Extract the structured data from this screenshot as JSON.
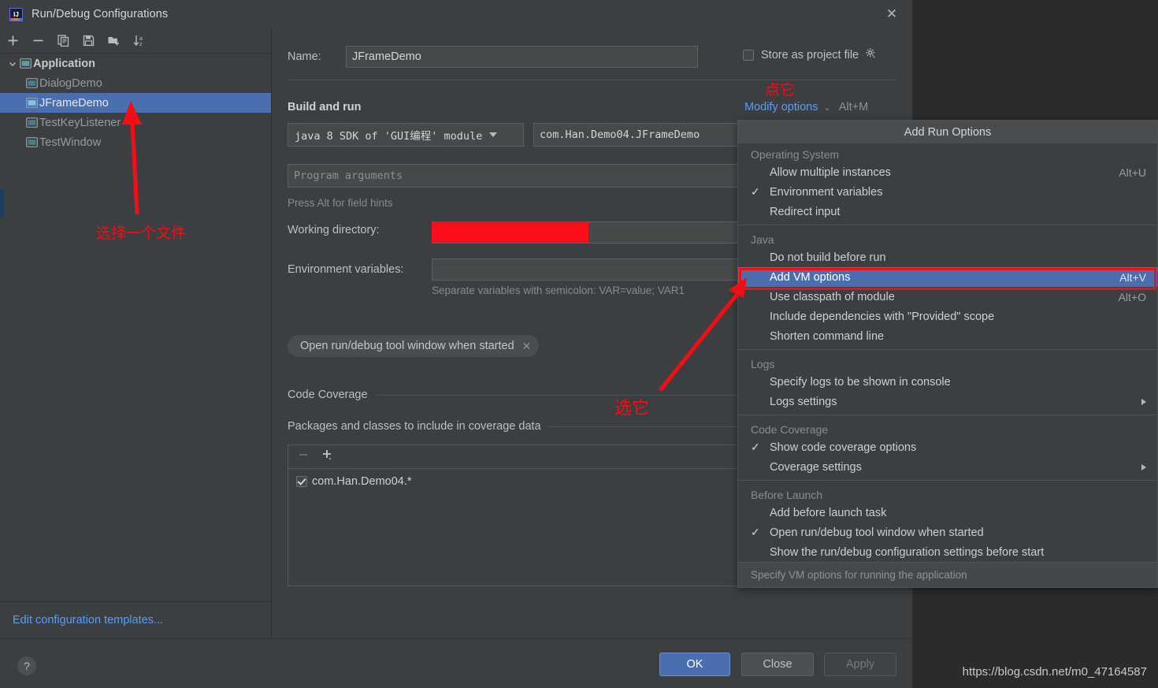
{
  "window": {
    "title": "Run/Debug Configurations",
    "app_icon": "intellij-idea-icon",
    "close_icon": "close-icon"
  },
  "sidebar": {
    "toolbar": [
      {
        "name": "add-configuration-button",
        "icon": "plus-icon"
      },
      {
        "name": "remove-configuration-button",
        "icon": "minus-icon"
      },
      {
        "name": "copy-configuration-button",
        "icon": "copy-icon"
      },
      {
        "name": "save-configuration-button",
        "icon": "save-icon"
      },
      {
        "name": "move-to-folder-button",
        "icon": "folder-add-icon"
      },
      {
        "name": "sort-configurations-button",
        "icon": "sort-az-icon"
      }
    ],
    "tree": [
      {
        "label": "Application",
        "level": 0,
        "expanded": true,
        "selected": false
      },
      {
        "label": "DialogDemo",
        "level": 1,
        "expanded": false,
        "selected": false
      },
      {
        "label": "JFrameDemo",
        "level": 1,
        "expanded": false,
        "selected": true
      },
      {
        "label": "TestKeyListener",
        "level": 1,
        "expanded": false,
        "selected": false
      },
      {
        "label": "TestWindow",
        "level": 1,
        "expanded": false,
        "selected": false
      }
    ],
    "footer_link": "Edit configuration templates..."
  },
  "form": {
    "name_label": "Name:",
    "name_value": "JFrameDemo",
    "store_as_project_file_label": "Store as project file",
    "store_as_project_file_checked": false,
    "store_gear_icon": "gear-dropdown-icon",
    "build_and_run_title": "Build and run",
    "modify_options_label": "Modify options",
    "modify_options_accel": "Alt+M",
    "sdk_value": "java 8 SDK of 'GUI编程' module",
    "main_class_value": "com.Han.Demo04.JFrameDemo",
    "program_arguments_placeholder": "Program arguments",
    "field_hint": "Press Alt for field hints",
    "working_directory_label": "Working directory:",
    "working_directory_value": "",
    "environment_variables_label": "Environment variables:",
    "environment_variables_value": "",
    "env_hint": "Separate variables with semicolon: VAR=value; VAR1",
    "tag_chip_label": "Open run/debug tool window when started",
    "tag_chip_close_icon": "chip-close-icon",
    "code_coverage_title": "Code Coverage",
    "packages_title": "Packages and classes to include in coverage data",
    "coverage_remove_icon": "minus-icon",
    "coverage_add_icon": "plus-dropdown-icon",
    "coverage_items": [
      {
        "label": "com.Han.Demo04.*",
        "checked": true
      }
    ]
  },
  "popup": {
    "title": "Add Run Options",
    "status_hint": "Specify VM options for running the application",
    "sections": [
      {
        "group": "Operating System",
        "items": [
          {
            "label": "Allow multiple instances",
            "accel": "Alt+U",
            "checked": false,
            "submenu": false,
            "highlight": false
          },
          {
            "label": "Environment variables",
            "accel": "",
            "checked": true,
            "submenu": false,
            "highlight": false
          },
          {
            "label": "Redirect input",
            "accel": "",
            "checked": false,
            "submenu": false,
            "highlight": false
          }
        ]
      },
      {
        "group": "Java",
        "items": [
          {
            "label": "Do not build before run",
            "accel": "",
            "checked": false,
            "submenu": false,
            "highlight": false
          },
          {
            "label": "Add VM options",
            "accel": "Alt+V",
            "checked": false,
            "submenu": false,
            "highlight": true
          },
          {
            "label": "Use classpath of module",
            "accel": "Alt+O",
            "checked": false,
            "submenu": false,
            "highlight": false
          },
          {
            "label": "Include dependencies with \"Provided\" scope",
            "accel": "",
            "checked": false,
            "submenu": false,
            "highlight": false
          },
          {
            "label": "Shorten command line",
            "accel": "",
            "checked": false,
            "submenu": false,
            "highlight": false
          }
        ]
      },
      {
        "group": "Logs",
        "items": [
          {
            "label": "Specify logs to be shown in console",
            "accel": "",
            "checked": false,
            "submenu": false,
            "highlight": false
          },
          {
            "label": "Logs settings",
            "accel": "",
            "checked": false,
            "submenu": true,
            "highlight": false
          }
        ]
      },
      {
        "group": "Code Coverage",
        "items": [
          {
            "label": "Show code coverage options",
            "accel": "",
            "checked": true,
            "submenu": false,
            "highlight": false
          },
          {
            "label": "Coverage settings",
            "accel": "",
            "checked": false,
            "submenu": true,
            "highlight": false
          }
        ]
      },
      {
        "group": "Before Launch",
        "items": [
          {
            "label": "Add before launch task",
            "accel": "",
            "checked": false,
            "submenu": false,
            "highlight": false
          },
          {
            "label": "Open run/debug tool window when started",
            "accel": "",
            "checked": true,
            "submenu": false,
            "highlight": false
          },
          {
            "label": "Show the run/debug configuration settings before start",
            "accel": "",
            "checked": false,
            "submenu": false,
            "highlight": false
          }
        ]
      }
    ]
  },
  "buttons": {
    "help_label": "?",
    "ok_label": "OK",
    "close_label": "Close",
    "apply_label": "Apply"
  },
  "annotations": {
    "select_file_note": "选择一个文件",
    "click_it_note": "点它",
    "choose_it_note": "选它",
    "accent_red": "#fb0a14"
  },
  "watermark": "https://blog.csdn.net/m0_47164587"
}
